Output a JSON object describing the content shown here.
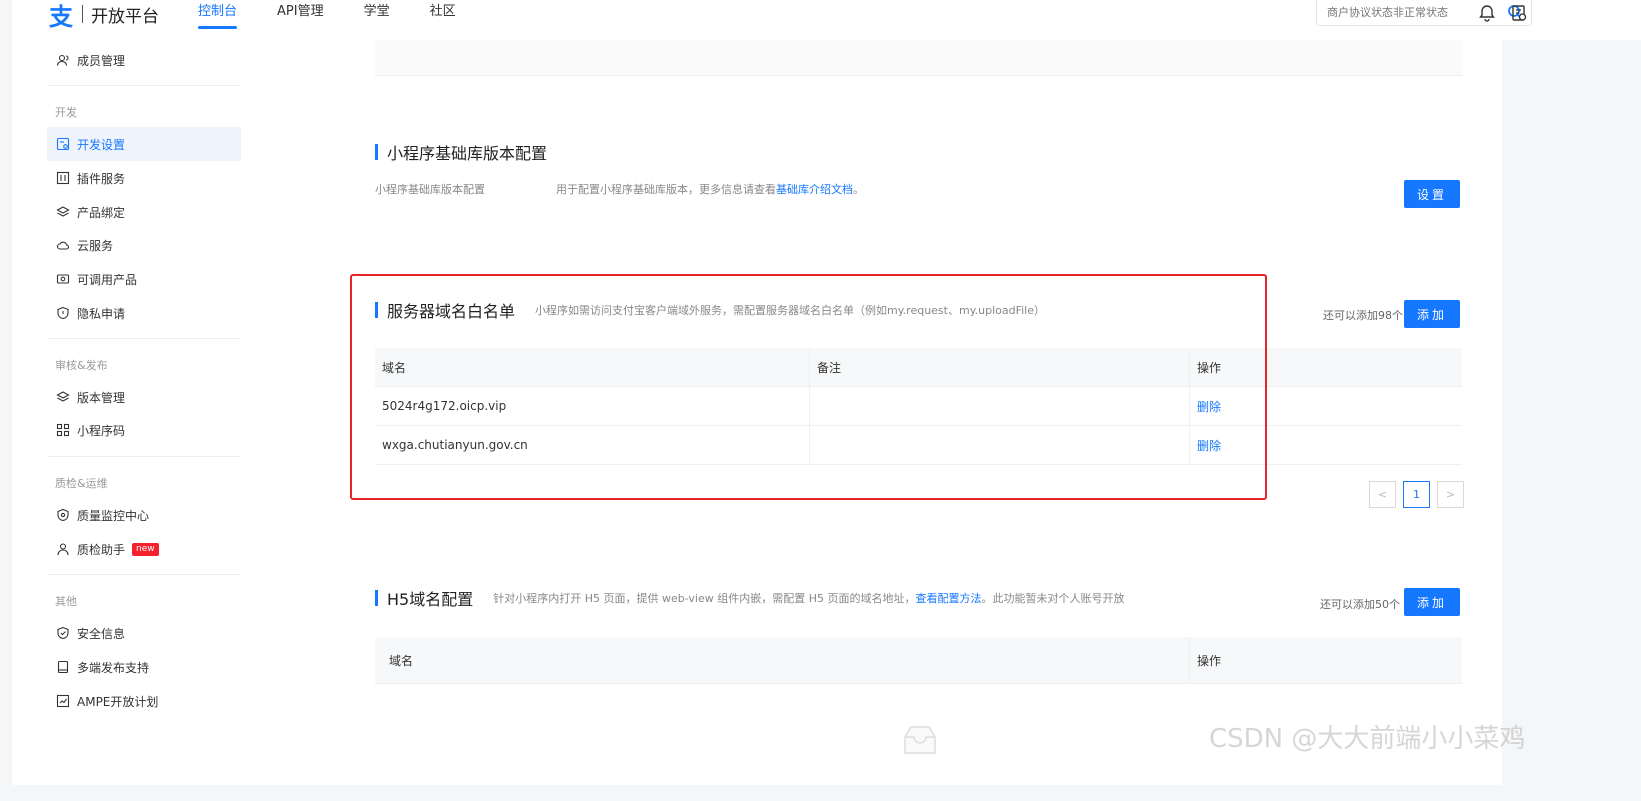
{
  "header": {
    "logo_glyph": "支",
    "logo_text": "开放平台",
    "nav": [
      "控制台",
      "API管理",
      "学堂",
      "社区"
    ],
    "search_placeholder": "商户协议状态非正常状态",
    "accent": "#1677ff"
  },
  "sidebar": {
    "top_item": "成员管理",
    "groups": [
      {
        "title": "开发",
        "items": [
          "开发设置",
          "插件服务",
          "产品绑定",
          "云服务",
          "可调用产品",
          "隐私申请"
        ]
      },
      {
        "title": "审核&发布",
        "items": [
          "版本管理",
          "小程序码"
        ]
      },
      {
        "title": "质检&运维",
        "items": [
          "质量监控中心",
          "质检助手"
        ]
      },
      {
        "title": "其他",
        "items": [
          "安全信息",
          "多端发布支持",
          "AMPE开放计划"
        ]
      }
    ],
    "active_item": "开发设置",
    "new_badge": "new"
  },
  "base_lib": {
    "title": "小程序基础库版本配置",
    "label": "小程序基础库版本配置",
    "desc_prefix": "用于配置小程序基础库版本，更多信息请查看",
    "desc_link": "基础库介绍文档",
    "desc_suffix": "。",
    "button": "设置"
  },
  "server_domain": {
    "title": "服务器域名白名单",
    "desc": "小程序如需访问支付宝客户端域外服务，需配置服务器域名白名单（例如my.request、my.uploadFile）",
    "quota": "还可以添加98个",
    "button": "添加",
    "columns": [
      "域名",
      "备注",
      "操作"
    ],
    "rows": [
      {
        "domain": "5024r4g172.oicp.vip",
        "remark": "",
        "action": "删除"
      },
      {
        "domain": "wxga.chutianyun.gov.cn",
        "remark": "",
        "action": "删除"
      }
    ],
    "pager": {
      "prev": "<",
      "current": "1",
      "next": ">"
    }
  },
  "h5_domain": {
    "title": "H5域名配置",
    "desc_prefix": "针对小程序内打开 H5 页面，提供 web-view 组件内嵌，需配置 H5 页面的域名地址，",
    "desc_link": "查看配置方法",
    "desc_suffix": "。此功能暂未对个人账号开放",
    "quota": "还可以添加50个",
    "button": "添加",
    "columns": [
      "域名",
      "操作"
    ]
  },
  "watermark": "CSDN @大大前端小小菜鸡"
}
